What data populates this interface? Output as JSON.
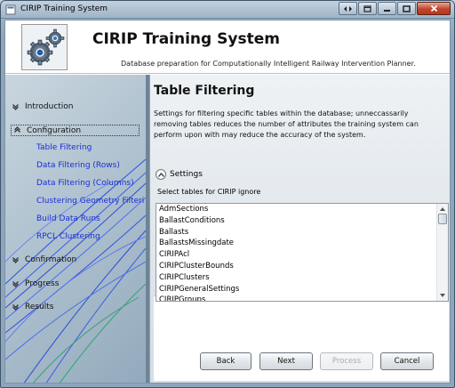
{
  "window": {
    "title": "CIRIP Training System"
  },
  "header": {
    "title": "CIRIP Training System",
    "subtitle": "Database preparation for Computationally Intelligent Railway Intervention Planner."
  },
  "sidebar": {
    "groups": [
      {
        "label": "Introduction",
        "expanded": false
      },
      {
        "label": "Configuration",
        "expanded": true,
        "active": true,
        "items": [
          "Table Filtering",
          "Data Filtering (Rows)",
          "Data Filtering (Columns)",
          "Clustering Geometry Filteri",
          "Build Data Runs",
          "RPCL Clustering"
        ]
      },
      {
        "label": "Confirmation",
        "expanded": false
      },
      {
        "label": "Progress",
        "expanded": false
      },
      {
        "label": "Results",
        "expanded": false
      }
    ]
  },
  "content": {
    "title": "Table Filtering",
    "description": "Settings for filtering specific tables within the database; unneccassarily removing tables reduces the number of attributes the training system can perform upon with may reduce the accuracy of the system.",
    "expander_label": "Settings",
    "list_label": "Select tables for CIRIP ignore",
    "tables": [
      "AdmSections",
      "BallastConditions",
      "Ballasts",
      "BallastsMissingdate",
      "CIRIPAcl",
      "CIRIPClusterBounds",
      "CIRIPClusters",
      "CIRIPGeneralSettings",
      "CIRIPGroups"
    ]
  },
  "buttons": {
    "back": "Back",
    "next": "Next",
    "process": "Process",
    "cancel": "Cancel"
  },
  "colors": {
    "link": "#1a2fd6",
    "close_button": "#c0452c"
  },
  "icons": {
    "sidebar_toggle": "chevron-icon",
    "logo": "gears-icon"
  }
}
